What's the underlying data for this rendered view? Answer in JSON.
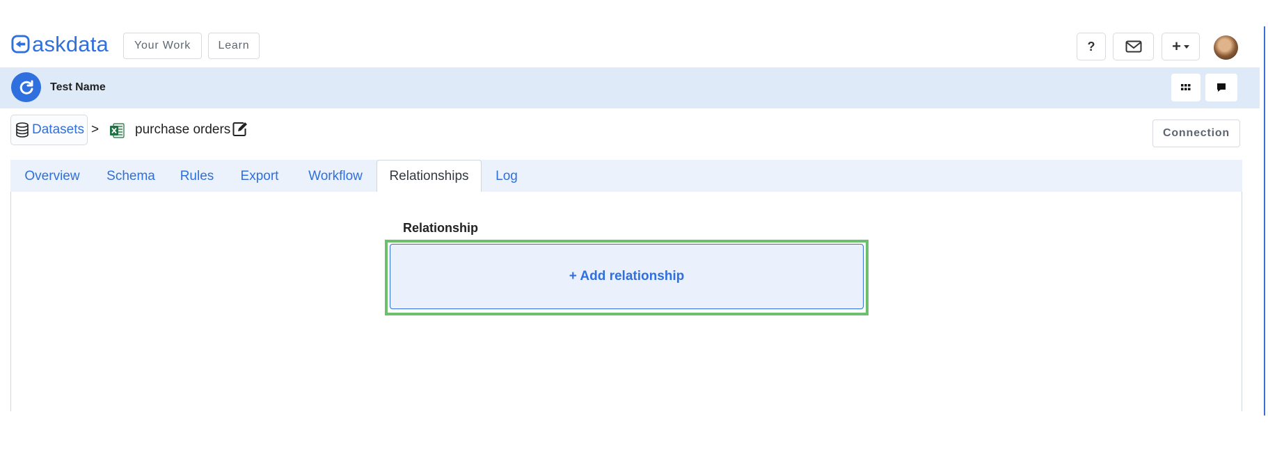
{
  "nav": {
    "brand": "askdata",
    "your_work": "Your Work",
    "learn": "Learn",
    "help_label": "?",
    "plus_label": "+",
    "icons": [
      "logo-icon",
      "mail-icon",
      "caret-down-icon",
      "avatar"
    ]
  },
  "org": {
    "name": "Test Name",
    "icons": [
      "refresh-icon",
      "grid-icon",
      "chat-icon"
    ]
  },
  "breadcrumb": {
    "datasets": "Datasets",
    "separator": ">",
    "dataset_name": "purchase orders",
    "connection": "Connection",
    "icons": [
      "database-icon",
      "excel-icon",
      "edit-icon"
    ]
  },
  "tabs": [
    {
      "label": "Overview",
      "active": false
    },
    {
      "label": "Schema",
      "active": false
    },
    {
      "label": "Rules",
      "active": false
    },
    {
      "label": "Export",
      "active": false
    },
    {
      "label": "Workflow",
      "active": false
    },
    {
      "label": "Relationships",
      "active": true
    },
    {
      "label": "Log",
      "active": false
    }
  ],
  "main": {
    "section_title": "Relationship",
    "add_button": "+ Add relationship"
  },
  "colors": {
    "accent": "#2f6fde",
    "org_bar": "#dfeaf8",
    "tab_bar": "#ebf2fb",
    "highlight": "#6cbf6c"
  }
}
